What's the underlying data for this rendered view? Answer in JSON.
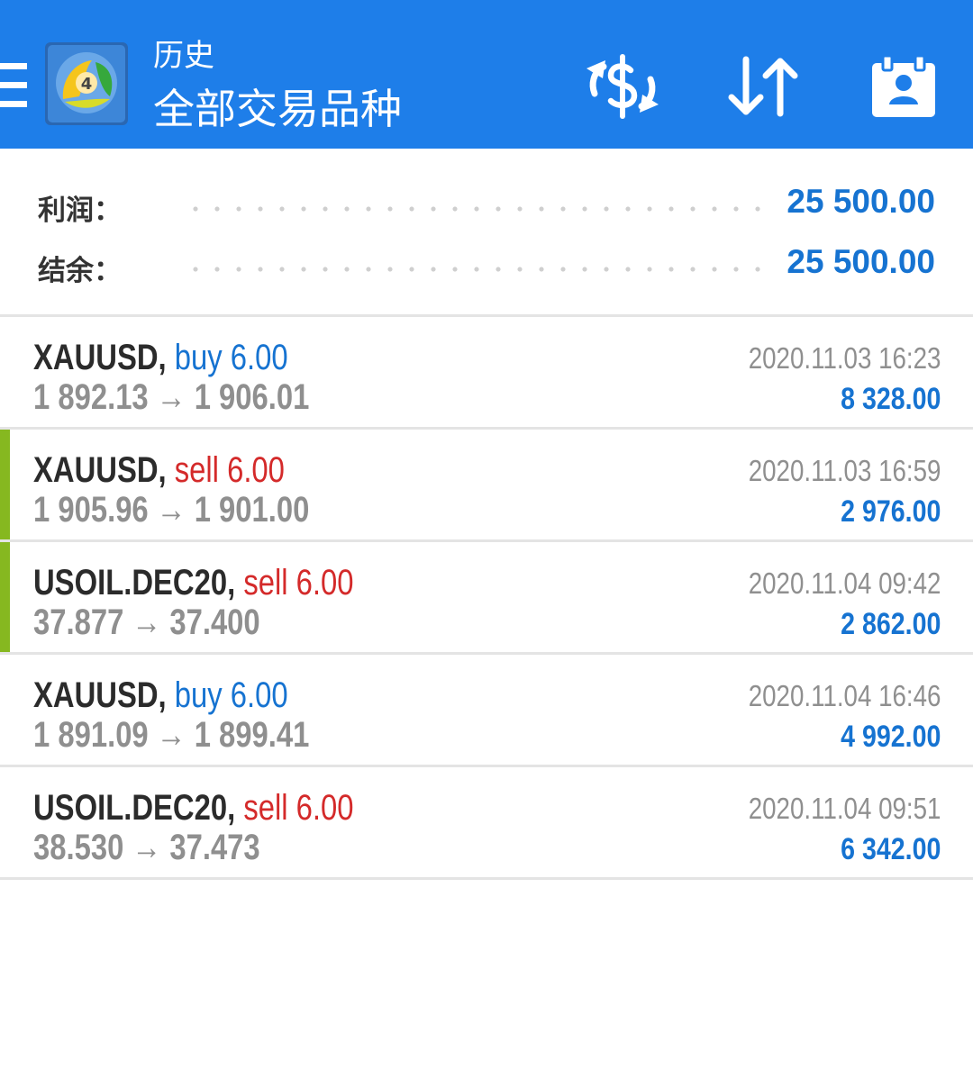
{
  "header": {
    "title": "历史",
    "subtitle": "全部交易品种",
    "colors": {
      "bar": "#1e7ee9",
      "text": "#ffffff"
    },
    "icons": [
      "menu-icon",
      "metatrader-logo",
      "currency-exchange-icon",
      "sort-icon",
      "account-icon"
    ]
  },
  "summary": {
    "profit_label": "利润：",
    "profit_value": "25 500.00",
    "balance_label": "结余：",
    "balance_value": "25 500.00"
  },
  "colors": {
    "buy": "#1673d1",
    "sell": "#d42a2a",
    "marker": "#86b820",
    "muted": "#8f8f8f"
  },
  "trades": [
    {
      "symbol": "XAUUSD,",
      "side": "buy 6.00",
      "prices": "1 892.13 → 1 906.01",
      "time": "2020.11.03 16:23",
      "profit": "8 328.00",
      "marked": false
    },
    {
      "symbol": "XAUUSD,",
      "side": "sell 6.00",
      "prices": "1 905.96 → 1 901.00",
      "time": "2020.11.03 16:59",
      "profit": "2 976.00",
      "marked": true
    },
    {
      "symbol": "USOIL.DEC20,",
      "side": "sell 6.00",
      "prices": "37.877 → 37.400",
      "time": "2020.11.04 09:42",
      "profit": "2 862.00",
      "marked": true
    },
    {
      "symbol": "XAUUSD,",
      "side": "buy 6.00",
      "prices": "1 891.09 → 1 899.41",
      "time": "2020.11.04 16:46",
      "profit": "4 992.00",
      "marked": false
    },
    {
      "symbol": "USOIL.DEC20,",
      "side": "sell 6.00",
      "prices": "38.530 → 37.473",
      "time": "2020.11.04 09:51",
      "profit": "6 342.00",
      "marked": false
    }
  ]
}
